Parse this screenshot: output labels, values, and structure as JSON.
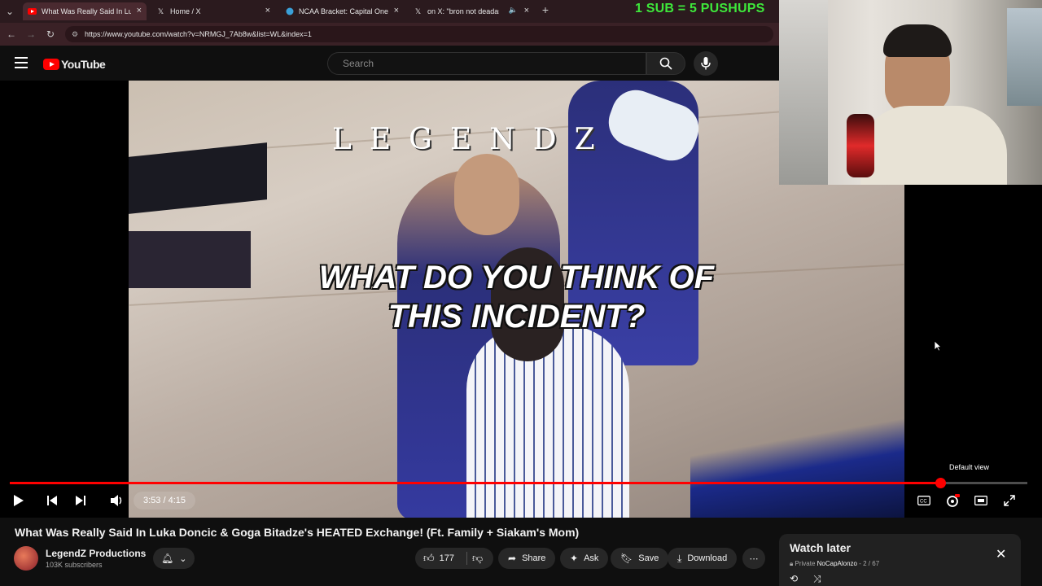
{
  "browser": {
    "tabs": [
      {
        "label": "What Was Really Said In Luka D",
        "icon": "youtube-icon",
        "active": true
      },
      {
        "label": "Home / X",
        "icon": "x-icon",
        "active": false
      },
      {
        "label": "NCAA Bracket: Capital One Ma",
        "icon": "globe-icon",
        "active": false
      },
      {
        "label": "on X: \"bron not deadass",
        "icon": "x-icon",
        "active": false
      }
    ],
    "new_tab": "+",
    "url": "https://www.youtube.com/watch?v=NRMGJ_7Ab8w&list=WL&index=1"
  },
  "overlay": {
    "banner": "1 SUB = 5 PUSHUPS"
  },
  "youtube": {
    "logo_text": "YouTube",
    "search_placeholder": "Search"
  },
  "video": {
    "watermark": "LEGENDZ",
    "caption_line1": "WHAT DO YOU THINK OF",
    "caption_line2": "THIS INCIDENT?",
    "time": "3:53 / 4:15",
    "progress": 0.914,
    "tooltip": "Default view"
  },
  "details": {
    "title": "What Was Really Said In Luka Doncic & Goga Bitadze's HEATED Exchange! (Ft. Family + Siakam's Mom)",
    "channel": "LegendZ Productions",
    "subscribers": "103K subscribers",
    "likes": "177",
    "share": "Share",
    "ask": "Ask",
    "save": "Save",
    "download": "Download"
  },
  "watch_later": {
    "title": "Watch later",
    "privacy": "Private",
    "owner": "NoCapAlonzo",
    "position": "- 2 / 67"
  },
  "colors": {
    "accent_red": "#ff0000",
    "banner_green": "#3ee83b"
  }
}
